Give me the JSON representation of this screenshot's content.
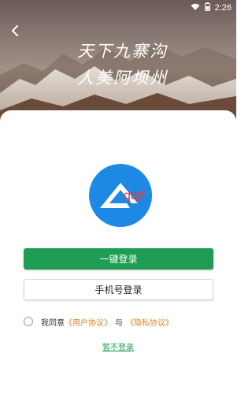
{
  "status_bar": {
    "time": "2:26"
  },
  "header": {
    "calligraphy_line1": "天下九寨沟",
    "calligraphy_line2": "人美阿坝州"
  },
  "logo": {
    "text": "qqtf",
    "color": "#1e88e5"
  },
  "buttons": {
    "quick_login": "一键登录",
    "phone_login": "手机号登录",
    "skip": "暂不登录"
  },
  "agreement": {
    "prefix": "我同意",
    "user_agreement": "《用户协议》",
    "and": "与",
    "privacy_agreement": "《隐私协议》"
  },
  "colors": {
    "primary_green": "#1f9d55",
    "link_orange": "#d9822b",
    "logo_blue": "#1e88e5"
  }
}
